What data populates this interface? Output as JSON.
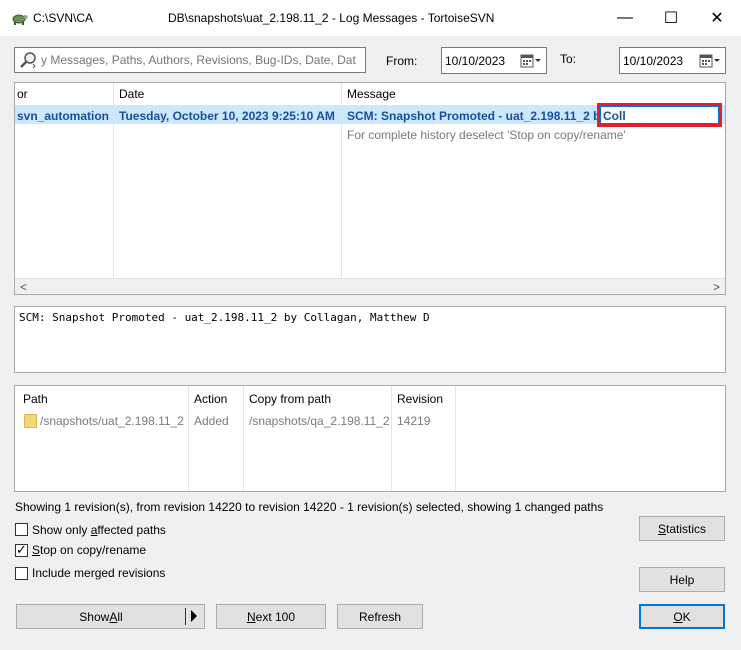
{
  "window": {
    "repo_path": "C:\\SVN\\CA",
    "title": "DB\\snapshots\\uat_2.198.11_2 - Log Messages - TortoiseSVN",
    "minimize": "—",
    "maximize": "☐",
    "close": "✕"
  },
  "filter": {
    "search_placeholder": "y Messages, Paths, Authors, Revisions, Bug-IDs, Date, Dat",
    "from_label": "From:",
    "from_value": "10/10/2023",
    "to_label": "To:",
    "to_value": "10/10/2023"
  },
  "log": {
    "columns": [
      "or",
      "Date",
      "Message"
    ],
    "rows": [
      {
        "author": "svn_automation",
        "date": "Tuesday, October 10, 2023 9:25:10 AM",
        "message": "SCM: Snapshot Promoted - uat_2.198.11_2 by",
        "message_edit": "Coll"
      }
    ],
    "hint": "For complete history deselect 'Stop on copy/rename'"
  },
  "message_pane": {
    "text": "SCM: Snapshot Promoted - uat_2.198.11_2 by Collagan, Matthew D"
  },
  "paths": {
    "columns": [
      "Path",
      "Action",
      "Copy from path",
      "Revision"
    ],
    "rows": [
      {
        "path": "/snapshots/uat_2.198.11_2",
        "action": "Added",
        "copy_from": "/snapshots/qa_2.198.11_2",
        "revision": "14219"
      }
    ]
  },
  "status_text": "Showing 1 revision(s), from revision 14220 to revision 14220 - 1 revision(s) selected, showing 1 changed paths",
  "options": {
    "show_affected": {
      "label_pre": "Show only ",
      "label_ul": "a",
      "label_post": "ffected paths",
      "checked": false
    },
    "stop_on_copy": {
      "label_pre": "",
      "label_ul": "S",
      "label_post": "top on copy/rename",
      "checked": true
    },
    "include_merged": {
      "label_pre": "Include merged revisions",
      "label_ul": "",
      "label_post": "",
      "checked": false
    }
  },
  "buttons": {
    "statistics_ul": "S",
    "statistics_rest": "tatistics",
    "help": "Help",
    "show_all_pre": "Show ",
    "show_all_ul": "A",
    "show_all_post": "ll",
    "next100_ul": "N",
    "next100_rest": "ext 100",
    "refresh": "Refresh",
    "ok_ul": "O",
    "ok_rest": "K"
  },
  "colors": {
    "selection": "#cce8ff",
    "selected_text": "#1a4e9c",
    "highlight_box": "#e0202a"
  }
}
